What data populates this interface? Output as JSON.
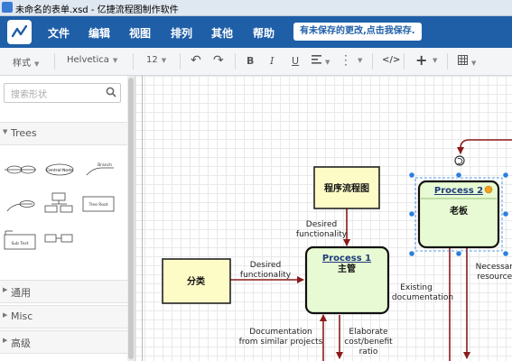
{
  "window": {
    "title": "未命名的表单.xsd - 亿捷流程图制作软件"
  },
  "menu": {
    "items": [
      "文件",
      "编辑",
      "视图",
      "排列",
      "其他",
      "帮助"
    ],
    "notice": "有未保存的更改,点击我保存."
  },
  "toolbar": {
    "style_label": "样式",
    "font": "Helvetica",
    "font_size": "12"
  },
  "sidebar": {
    "search_placeholder": "搜索形状",
    "sections": {
      "trees": "Trees",
      "general": "通用",
      "misc": "Misc",
      "advanced": "高级"
    },
    "shape_texts": {
      "circle_node": "Central Node",
      "line_label": "Branch",
      "box": "Tree Root",
      "sub_text": "Sub Text"
    }
  },
  "diagram": {
    "nodes": {
      "flowchart_label": "程序流程图",
      "classify_label": "分类",
      "process1": {
        "title": "Process 1",
        "subtitle": "主管"
      },
      "process2": {
        "title": "Process 2",
        "subtitle": "老板"
      }
    },
    "edge_labels": {
      "desired_functionality": [
        "Desired",
        "functionality"
      ],
      "desired_functionality_2": [
        "Desired",
        "functionality"
      ],
      "documentation": [
        "Documentation",
        "from similar projects"
      ],
      "elaborate": [
        "Elaborate",
        "cost/benefit",
        "ratio"
      ],
      "existing": [
        "Existing",
        "documentation"
      ],
      "necessary": [
        "Necessary",
        "resources"
      ]
    }
  },
  "colors": {
    "menubar": "#1f5fa8",
    "process_fill": "#e7fad3",
    "label_fill": "#fdfbc6",
    "edge": "#8b1a1a",
    "selection": "#2a7fdd"
  }
}
